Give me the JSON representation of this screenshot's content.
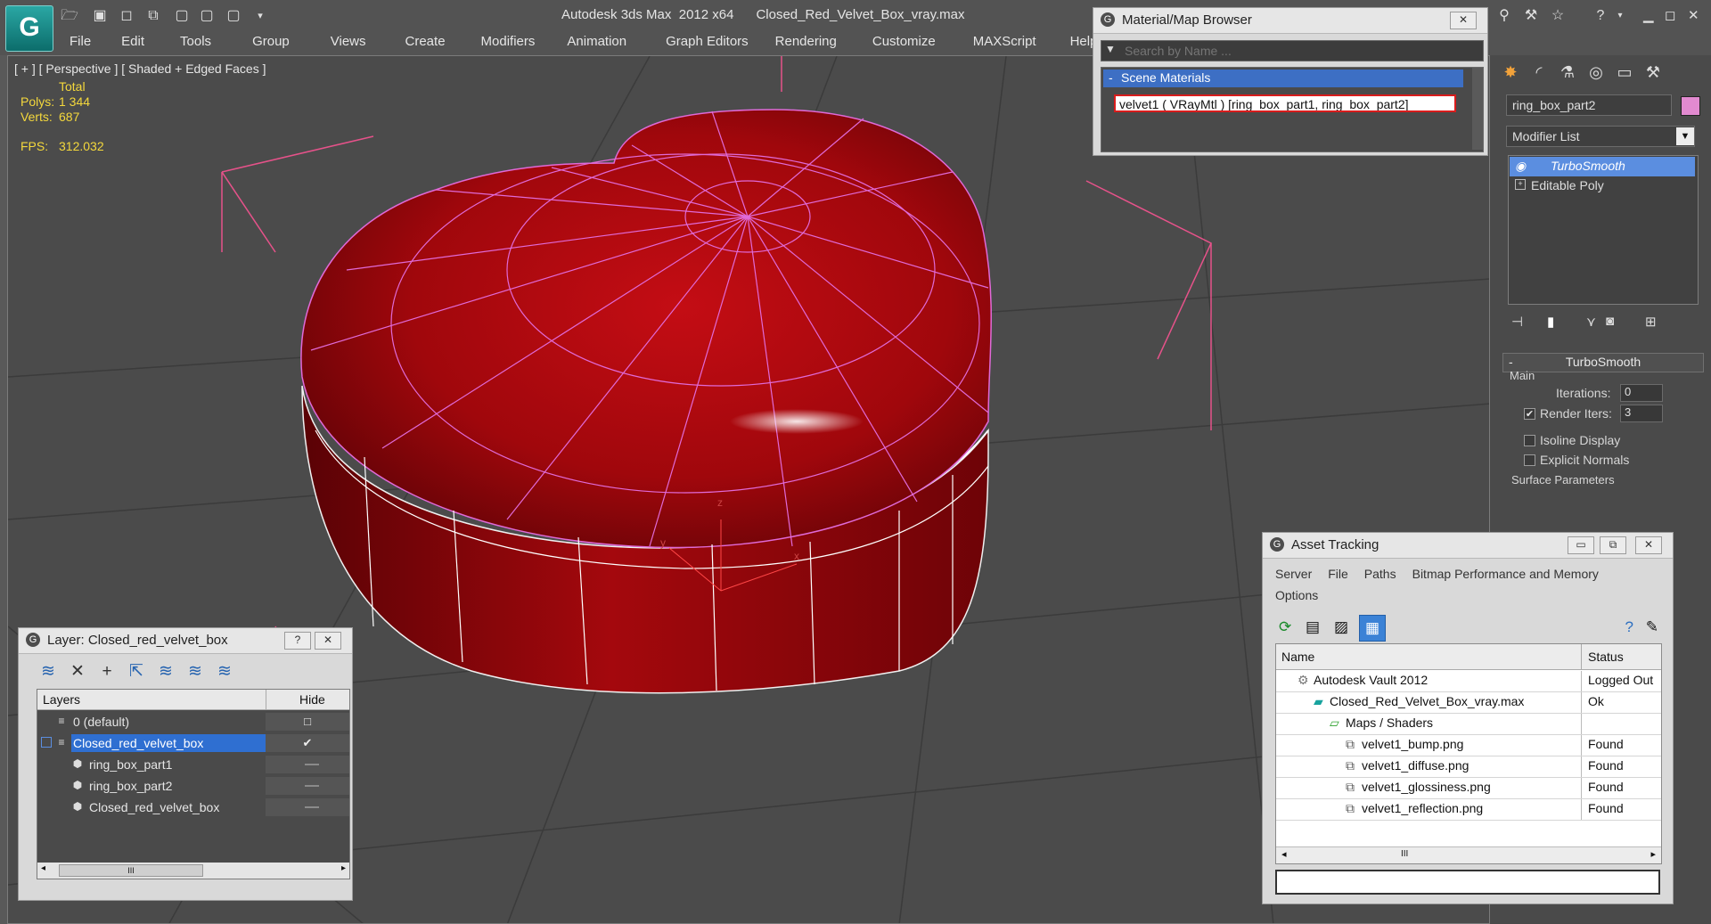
{
  "app": {
    "title": "Autodesk 3ds Max  2012 x64      Closed_Red_Velvet_Box_vray.max",
    "logo_letter": "G"
  },
  "quick_access": [
    {
      "icon": "folder-open-icon",
      "glyph": "🗁"
    },
    {
      "icon": "save-icon",
      "glyph": "▣"
    },
    {
      "icon": "new-scene-icon",
      "glyph": "◻"
    },
    {
      "icon": "hold-icon",
      "glyph": "⧉"
    },
    {
      "icon": "fetch-icon",
      "glyph": "▢"
    },
    {
      "icon": "undo-icon",
      "glyph": "▢"
    },
    {
      "icon": "redo-icon",
      "glyph": "▢"
    },
    {
      "icon": "dropdown-arrow-icon",
      "glyph": "▾"
    }
  ],
  "menu": [
    "File",
    "Edit",
    "Tools",
    "Group",
    "Views",
    "Create",
    "Modifiers",
    "Animation",
    "Graph Editors",
    "Rendering",
    "Customize",
    "MAXScript",
    "Help"
  ],
  "viewport": {
    "label": "[ + ] [ Perspective ] [ Shaded + Edged Faces ]",
    "stats": {
      "header": "Total",
      "polys_label": "Polys:",
      "polys_value": "1 344",
      "verts_label": "Verts:",
      "verts_value": "687",
      "fps_label": "FPS:",
      "fps_value": "312.032"
    },
    "axis": {
      "x": "x",
      "y": "y",
      "z": "z"
    }
  },
  "material_browser": {
    "title": "Material/Map Browser",
    "search_placeholder": "Search by Name ...",
    "group": "Scene Materials",
    "item": "velvet1  ( VRayMtl )  [ring_box_part1, ring_box_part2]",
    "close": "✕",
    "colors": {
      "highlight_border": "#d91c1c",
      "group_bg": "#3d6fc4"
    }
  },
  "command_panel": {
    "tabs": [
      {
        "icon": "create-tab-icon",
        "glyph": "✸"
      },
      {
        "icon": "modify-tab-icon",
        "glyph": "◜"
      },
      {
        "icon": "hierarchy-tab-icon",
        "glyph": "⚗"
      },
      {
        "icon": "motion-tab-icon",
        "glyph": "◎"
      },
      {
        "icon": "display-tab-icon",
        "glyph": "▭"
      },
      {
        "icon": "utilities-tab-icon",
        "glyph": "⚒"
      }
    ],
    "object_name": "ring_box_part2",
    "object_color": "#e28ad0",
    "modifier_list_label": "Modifier List",
    "stack": [
      {
        "label": "TurboSmooth",
        "selected": true
      },
      {
        "label": "Editable Poly",
        "selected": false
      }
    ],
    "rollout_title": "TurboSmooth",
    "main_label": "Main",
    "iterations_label": "Iterations:",
    "iterations_value": "0",
    "render_iters_label": "Render Iters:",
    "render_iters_value": "3",
    "render_iters_checked": "✔",
    "isoline_label": "Isoline Display",
    "explicit_normals_label": "Explicit Normals",
    "surface_params_label": "Surface Parameters",
    "collapse_sign": "-"
  },
  "layer_dialog": {
    "title": "Layer: Closed_red_velvet_box",
    "help": "?",
    "close": "✕",
    "toolbar": [
      {
        "icon": "create-layer-icon",
        "glyph": "≋"
      },
      {
        "icon": "delete-layer-icon",
        "glyph": "✕"
      },
      {
        "icon": "add-to-layer-icon",
        "glyph": "+"
      },
      {
        "icon": "select-objects-icon",
        "glyph": "⇱"
      },
      {
        "icon": "highlight-layer-icon",
        "glyph": "≋"
      },
      {
        "icon": "hide-all-icon",
        "glyph": "≋"
      },
      {
        "icon": "freeze-all-icon",
        "glyph": "≋"
      }
    ],
    "col_layers": "Layers",
    "col_hide": "Hide",
    "rows": [
      {
        "label": "0 (default)",
        "indent": 0,
        "selected": false,
        "hide": "□"
      },
      {
        "label": "Closed_red_velvet_box",
        "indent": 0,
        "selected": true,
        "hide": "✔"
      },
      {
        "label": "ring_box_part1",
        "indent": 1,
        "selected": false,
        "hide": ""
      },
      {
        "label": "ring_box_part2",
        "indent": 1,
        "selected": false,
        "hide": ""
      },
      {
        "label": "Closed_red_velvet_box",
        "indent": 1,
        "selected": false,
        "hide": ""
      }
    ],
    "scroll_grip": "III"
  },
  "asset_tracking": {
    "title": "Asset Tracking",
    "menu1": [
      "Server",
      "File",
      "Paths",
      "Bitmap Performance and Memory"
    ],
    "menu2": [
      "Options"
    ],
    "col_name": "Name",
    "col_status": "Status",
    "rows": [
      {
        "name": "Autodesk Vault 2012",
        "status": "Logged Out",
        "indent": 1,
        "icon": "vault-icon"
      },
      {
        "name": "Closed_Red_Velvet_Box_vray.max",
        "status": "Ok",
        "indent": 2,
        "icon": "max-file-icon"
      },
      {
        "name": "Maps / Shaders",
        "status": "",
        "indent": 3,
        "icon": "maps-folder-icon"
      },
      {
        "name": "velvet1_bump.png",
        "status": "Found",
        "indent": 4,
        "icon": "bitmap-icon"
      },
      {
        "name": "velvet1_diffuse.png",
        "status": "Found",
        "indent": 4,
        "icon": "bitmap-icon"
      },
      {
        "name": "velvet1_glossiness.png",
        "status": "Found",
        "indent": 4,
        "icon": "bitmap-icon"
      },
      {
        "name": "velvet1_reflection.png",
        "status": "Found",
        "indent": 4,
        "icon": "bitmap-icon"
      }
    ],
    "scroll_grip": "III",
    "scroll_left": "◂",
    "scroll_right": "▸"
  }
}
